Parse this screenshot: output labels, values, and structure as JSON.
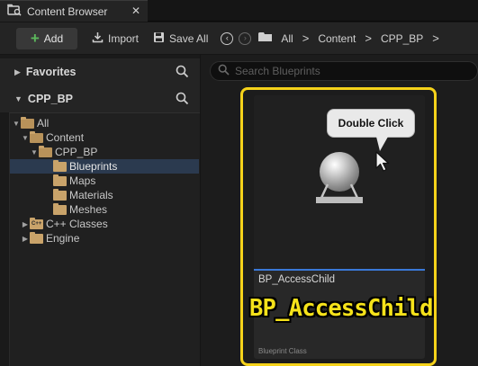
{
  "tab": {
    "title": "Content Browser",
    "close_glyph": "✕"
  },
  "toolbar": {
    "add_label": "Add",
    "import_label": "Import",
    "save_all_label": "Save All",
    "breadcrumbs": [
      "All",
      "Content",
      "CPP_BP"
    ],
    "separator_glyph": ">"
  },
  "sections": {
    "favorites": "Favorites",
    "project": "CPP_BP"
  },
  "tree": [
    {
      "label": "All"
    },
    {
      "label": "Content"
    },
    {
      "label": "CPP_BP"
    },
    {
      "label": "Blueprints",
      "selected": true
    },
    {
      "label": "Maps"
    },
    {
      "label": "Materials"
    },
    {
      "label": "Meshes"
    },
    {
      "label": "C++ Classes"
    },
    {
      "label": "Engine"
    }
  ],
  "search": {
    "placeholder": "Search Blueprints"
  },
  "asset": {
    "name": "BP_AccessChild",
    "type": "Blueprint Class",
    "tooltip": "Double Click",
    "overlay_label": "BP_AccessChild"
  },
  "colors": {
    "highlight": "#f5d21a",
    "accent_blue": "#3a78d8",
    "add_green": "#5cb85c",
    "selection": "#2b3a4f"
  },
  "icons": [
    "content-browser-icon",
    "close-icon",
    "plus-icon",
    "import-icon",
    "save-icon",
    "back-icon",
    "forward-icon",
    "folder-icon",
    "search-icon",
    "mouse-cursor-icon"
  ]
}
